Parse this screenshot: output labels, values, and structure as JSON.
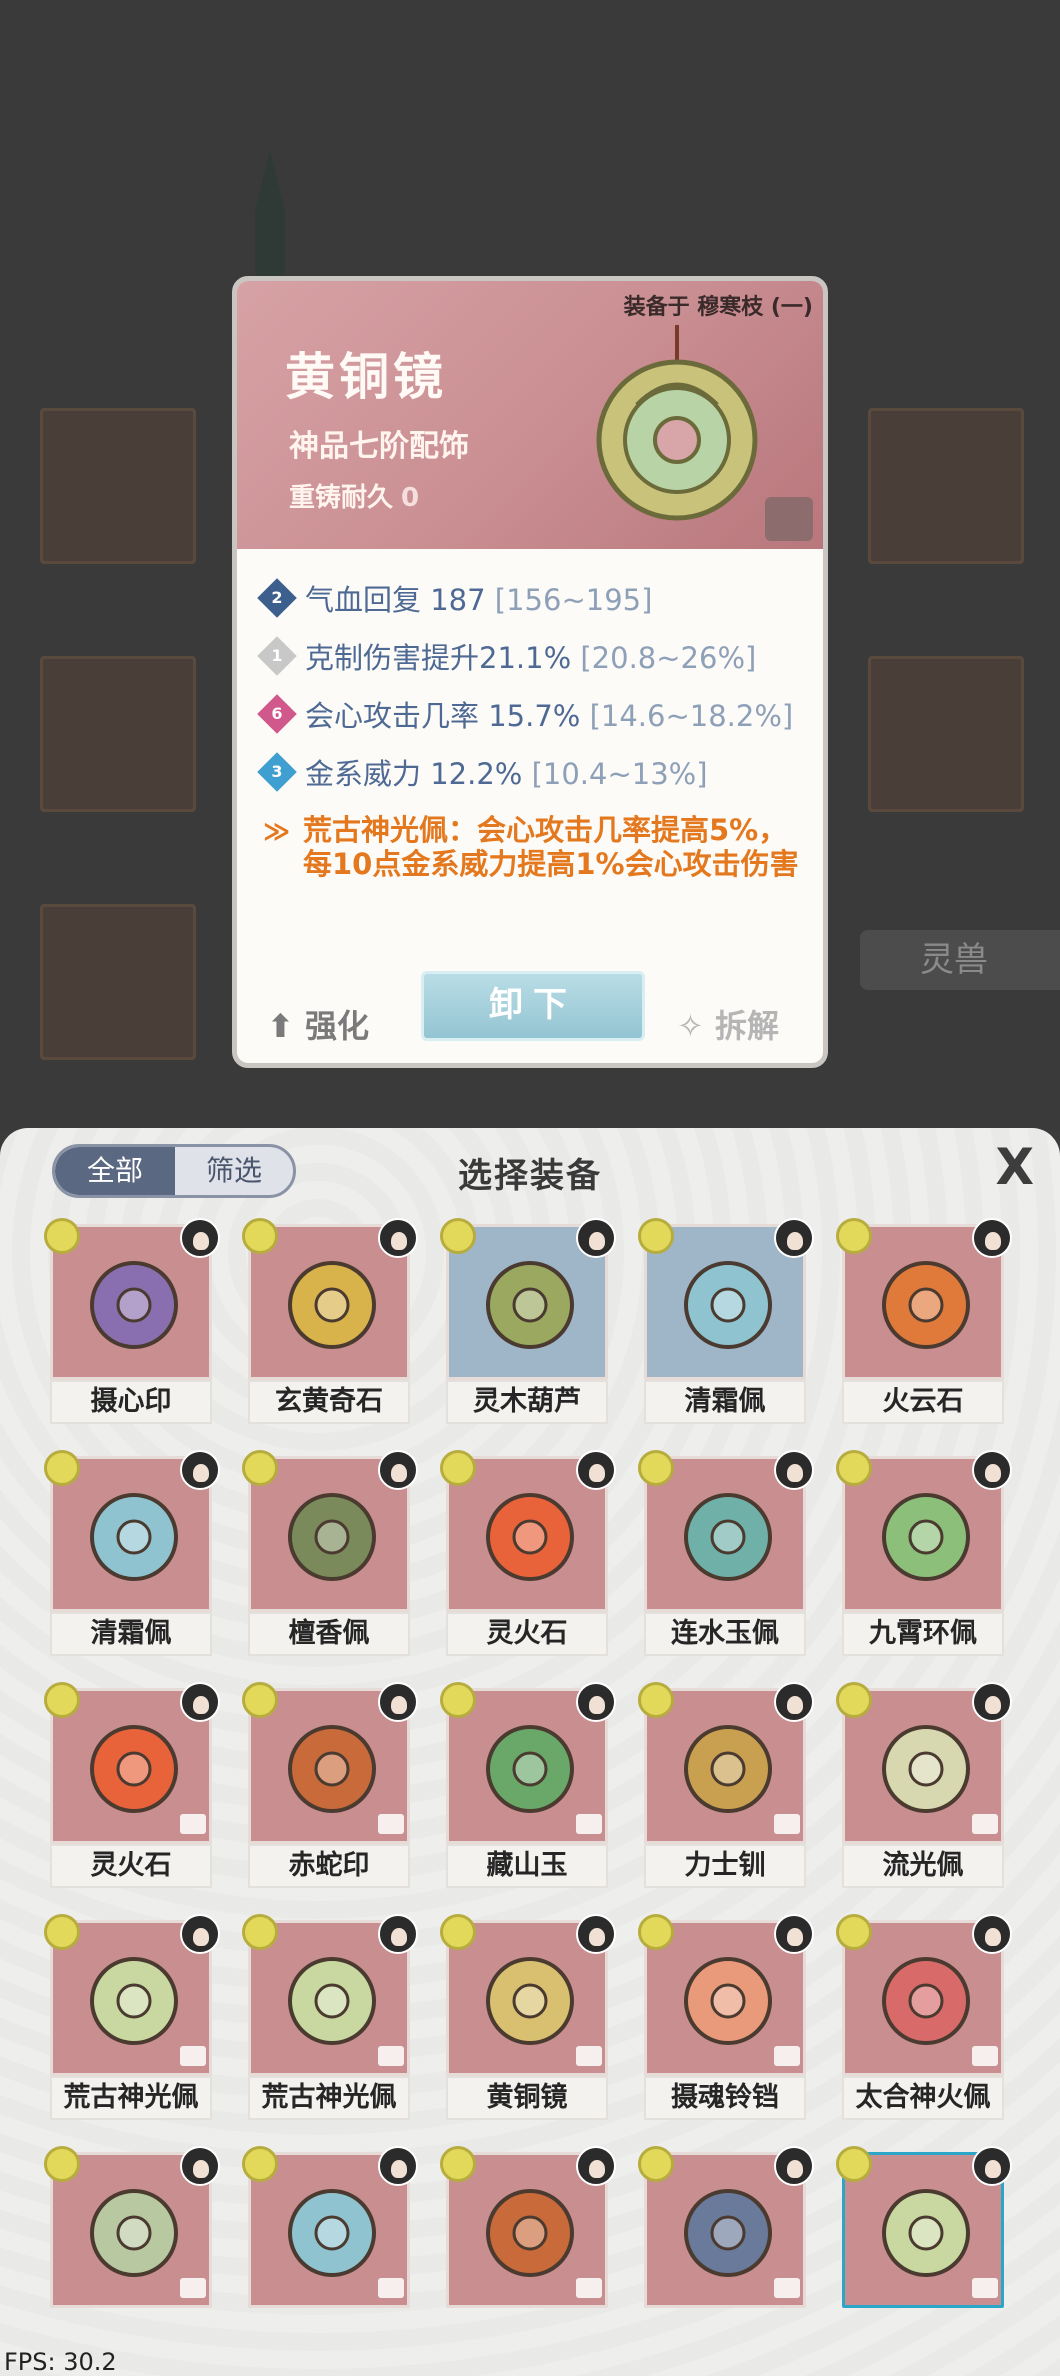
{
  "tooltip": {
    "equipped_on": "装备于 穆寒枝 (一)",
    "name": "黄铜镜",
    "grade": "神品七阶配饰",
    "recast_label": "重铸耐久",
    "recast_value": "0",
    "attributes": [
      {
        "badge": "2",
        "color": "#3d5f8e",
        "text": "气血回复 187 ",
        "range": "[156~195]"
      },
      {
        "badge": "1",
        "color": "#c8c8c8",
        "text": "克制伤害提升21.1% ",
        "range": "[20.8~26%]"
      },
      {
        "badge": "6",
        "color": "#d0588a",
        "text": "会心攻击几率 15.7% ",
        "range": "[14.6~18.2%]"
      },
      {
        "badge": "3",
        "color": "#3e9fd0",
        "text": "金系威力 12.2% ",
        "range": "[10.4~13%]"
      }
    ],
    "set_effect": "荒古神光佩：会心攻击几率提高5%，每10点金系威力提高1%会心攻击伤害",
    "enhance_label": "强化",
    "unequip_label": "卸下",
    "dismantle_label": "拆解"
  },
  "background": {
    "tab_label": "灵兽"
  },
  "panel": {
    "filter_all": "全部",
    "filter_select": "筛选",
    "title": "选择装备",
    "close": "X"
  },
  "items": [
    {
      "name": "摄心印",
      "bg": "pink",
      "icon_color": "#8a6fb0"
    },
    {
      "name": "玄黄奇石",
      "bg": "pink",
      "icon_color": "#d8b24a"
    },
    {
      "name": "灵木葫芦",
      "bg": "blue",
      "icon_color": "#9aa860"
    },
    {
      "name": "清霜佩",
      "bg": "blue",
      "icon_color": "#8fc3d0"
    },
    {
      "name": "火云石",
      "bg": "pink",
      "icon_color": "#e07a3a"
    },
    {
      "name": "清霜佩",
      "bg": "pink",
      "icon_color": "#8fc3d0"
    },
    {
      "name": "檀香佩",
      "bg": "pink",
      "icon_color": "#7a8a5a"
    },
    {
      "name": "灵火石",
      "bg": "pink",
      "icon_color": "#e8623a"
    },
    {
      "name": "连水玉佩",
      "bg": "pink",
      "icon_color": "#6fb0a8"
    },
    {
      "name": "九霄环佩",
      "bg": "pink",
      "icon_color": "#8cbf7a"
    },
    {
      "name": "灵火石",
      "bg": "pink",
      "icon_color": "#e8623a"
    },
    {
      "name": "赤蛇印",
      "bg": "pink",
      "icon_color": "#c86a3a"
    },
    {
      "name": "藏山玉",
      "bg": "pink",
      "icon_color": "#6aa86a"
    },
    {
      "name": "力士钏",
      "bg": "pink",
      "icon_color": "#c8a050"
    },
    {
      "name": "流光佩",
      "bg": "pink",
      "icon_color": "#d8d8b0"
    },
    {
      "name": "荒古神光佩",
      "bg": "pink",
      "icon_color": "#c8d8a0"
    },
    {
      "name": "荒古神光佩",
      "bg": "pink",
      "icon_color": "#c8d8a0"
    },
    {
      "name": "黄铜镜",
      "bg": "pink",
      "icon_color": "#d8c070"
    },
    {
      "name": "摄魂铃铛",
      "bg": "pink",
      "icon_color": "#e89a7a"
    },
    {
      "name": "太合神火佩",
      "bg": "pink",
      "icon_color": "#d86a6a"
    },
    {
      "name": "",
      "bg": "pink",
      "icon_color": "#b8c8a0"
    },
    {
      "name": "",
      "bg": "pink",
      "icon_color": "#8fc3d0"
    },
    {
      "name": "",
      "bg": "pink",
      "icon_color": "#c86a3a"
    },
    {
      "name": "",
      "bg": "pink",
      "icon_color": "#6a7a9a"
    },
    {
      "name": "",
      "bg": "pink",
      "icon_color": "#c8d8a0"
    }
  ],
  "fps": "FPS: 30.2"
}
